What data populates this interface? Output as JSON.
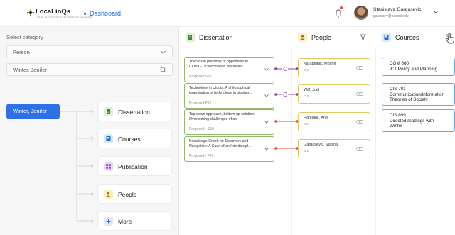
{
  "header": {
    "logo_text": "LocaLinQs",
    "logo_subtitle": "LOCAL ALIGNMENT EXPLORATION DATABASE",
    "nav_dashboard": "Dashboard",
    "user_name": "Stanislava Gardasevic",
    "user_email": "gardasev@hawaii.edu"
  },
  "filter": {
    "category_label": "Select category",
    "category_value": "Person",
    "search_value": "Winter, Jenifer"
  },
  "tree": {
    "root": "Winter, Jenifer",
    "items": [
      {
        "label": "Dissertation",
        "icon": "document-icon",
        "color": "#dff0d2"
      },
      {
        "label": "Courses",
        "icon": "book-icon",
        "color": "#d6e8fb"
      },
      {
        "label": "Publication",
        "icon": "grid-icon",
        "color": "#ead8f8"
      },
      {
        "label": "People",
        "icon": "person-icon",
        "color": "#fbf0c4"
      },
      {
        "label": "More",
        "icon": "plus-icon",
        "color": "#dfe9fa"
      }
    ]
  },
  "columns": {
    "dissertation": "Dissertation",
    "people": "People",
    "courses": "Courses"
  },
  "dissertations": [
    {
      "title": "The visual practices of opponents to COVID-19 vaccination mandates",
      "status": "Proposed S22"
    },
    {
      "title": "Technology in Utopia: A philosophical examination of technology in utopian...",
      "status": "Proposed F22"
    },
    {
      "title": "Top-down approach, bottom-up solution: Overcoming challenges of an",
      "status": "Proposed - S19"
    },
    {
      "title": "Knowledge Graph for Discovery and Navigation: A Case of an Interdiscipl...",
      "status": "Proposed - F20"
    }
  ],
  "people": [
    {
      "name": "Karabelnik, Moshe",
      "role": "CIS"
    },
    {
      "name": "Wilf, Joel",
      "role": "CIS"
    },
    {
      "name": "Hamidali, Anis",
      "role": "ITM"
    },
    {
      "name": "Gardasevic, Stasha",
      "role": "CIS"
    }
  ],
  "links": [
    {
      "label": "C",
      "color": "#8e44ad"
    },
    {
      "label": "C",
      "color": "#8e44ad"
    },
    {
      "label": "",
      "color": "#e74c3c"
    },
    {
      "label": "",
      "color": "#e74c3c"
    }
  ],
  "courses": [
    {
      "code": "COM 660",
      "name": "ICT Policy and Planning"
    },
    {
      "code": "CIS 701",
      "name": "Communication/Information Theories of Society"
    },
    {
      "code": "CIS 699",
      "name": "Directed readings with Winter"
    }
  ],
  "colors": {
    "accent": "#2c72e6",
    "dissertation_border": "#8dbb6c",
    "people_border": "#e0c868",
    "courses_border": "#6aa7e0"
  }
}
